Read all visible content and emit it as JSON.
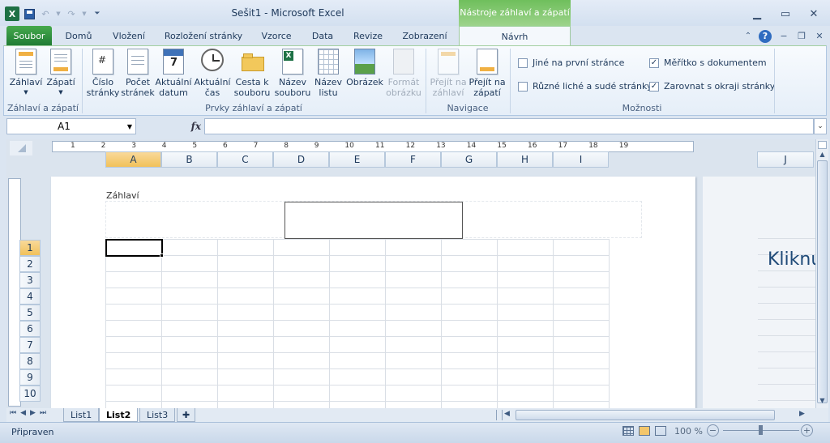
{
  "window": {
    "title": "Sešit1  -  Microsoft Excel",
    "context_tab": "Nástroje záhlaví a zápatí"
  },
  "qat": {
    "undo": "↶",
    "redo": "↷"
  },
  "tabs": [
    "Soubor",
    "Domů",
    "Vložení",
    "Rozložení stránky",
    "Vzorce",
    "Data",
    "Revize",
    "Zobrazení",
    "Návrh"
  ],
  "ribbon": {
    "groups": {
      "g1": "Záhlaví a zápatí",
      "g2": "Prvky záhlaví a zápatí",
      "g3": "Navigace",
      "g4": "Možnosti"
    },
    "buttons": {
      "zahlavi": "Záhlaví",
      "zapati": "Zápatí",
      "cislo1": "Číslo",
      "cislo2": "stránky",
      "pocet1": "Počet",
      "pocet2": "stránek",
      "datum1": "Aktuální",
      "datum2": "datum",
      "cas1": "Aktuální",
      "cas2": "čas",
      "cesta1": "Cesta k",
      "cesta2": "souboru",
      "nazevs1": "Název",
      "nazevs2": "souboru",
      "nazevl1": "Název",
      "nazevl2": "listu",
      "obrazek": "Obrázek",
      "format1": "Formát",
      "format2": "obrázku",
      "nazah1": "Přejít na",
      "nazah2": "záhlaví",
      "nazap1": "Přejít na",
      "nazap2": "zápatí"
    },
    "options": {
      "opt1": "Jiné na první stránce",
      "opt2": "Různé liché a sudé stránky",
      "opt3": "Měřítko s dokumentem",
      "opt4": "Zarovnat s okraji stránky"
    },
    "datum_num": "7"
  },
  "formula_bar": {
    "name_box": "A1",
    "fx": "fx",
    "value": ""
  },
  "columns": [
    "A",
    "B",
    "C",
    "D",
    "E",
    "F",
    "G",
    "H",
    "I"
  ],
  "column_j": "J",
  "rows": [
    "1",
    "2",
    "3",
    "4",
    "5",
    "6",
    "7",
    "8",
    "9",
    "10"
  ],
  "ruler_numbers": [
    "1",
    "2",
    "3",
    "4",
    "5",
    "6",
    "7",
    "8",
    "9",
    "10",
    "11",
    "12",
    "13",
    "14",
    "15",
    "16",
    "17",
    "18",
    "19"
  ],
  "page": {
    "header_label": "Záhlaví",
    "page2_text": "Kliknu"
  },
  "sheets": [
    "List1",
    "List2",
    "List3"
  ],
  "status": {
    "ready": "Připraven",
    "zoom": "100 %"
  },
  "colors": {
    "accent_green": "#2b8a3e",
    "selection": "#f1c15a"
  }
}
